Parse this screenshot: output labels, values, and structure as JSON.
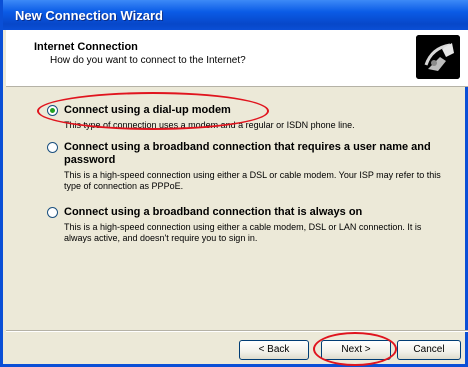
{
  "window": {
    "title": "New Connection Wizard"
  },
  "header": {
    "title": "Internet Connection",
    "subtitle": "How do you want to connect to the Internet?",
    "icon": "wizard-connection-icon"
  },
  "options": [
    {
      "label": "Connect using a dial-up modem",
      "description": "This type of connection uses a modem and a regular or ISDN phone line.",
      "selected": true
    },
    {
      "label": "Connect using a broadband connection that requires a user name and password",
      "description": "This is a high-speed connection using either a DSL or cable modem. Your ISP may refer to this type of connection as PPPoE.",
      "selected": false
    },
    {
      "label": "Connect using a broadband connection that is always on",
      "description": "This is a high-speed connection using either a cable modem, DSL or LAN connection. It is always active, and doesn't require you to sign in.",
      "selected": false
    }
  ],
  "buttons": {
    "back": "< Back",
    "next": "Next >",
    "cancel": "Cancel"
  },
  "colors": {
    "titlebar": "#0a5be6",
    "highlight_ring": "#e0141e",
    "radio_check": "#21a121"
  }
}
